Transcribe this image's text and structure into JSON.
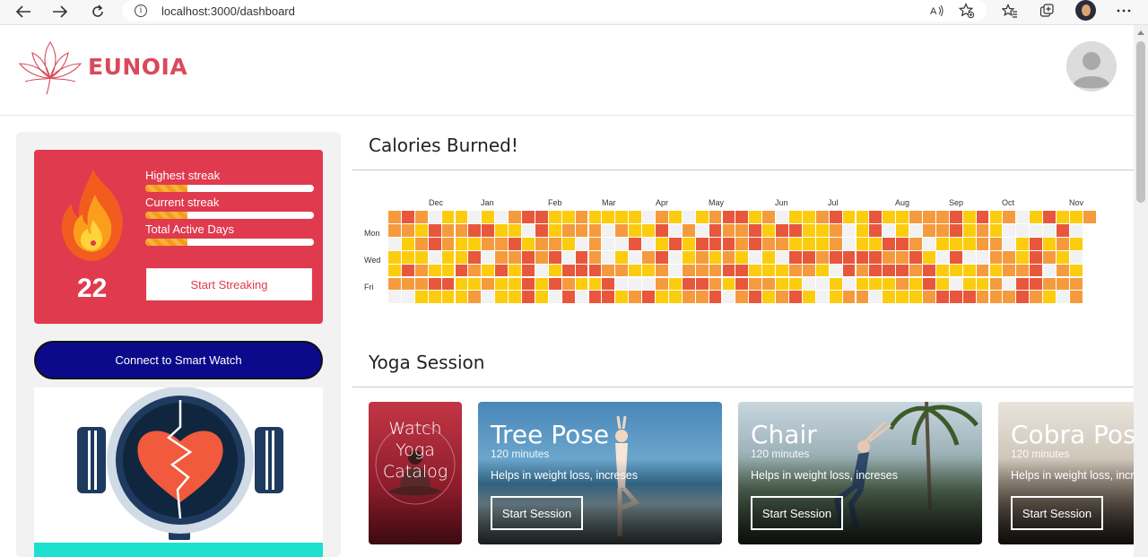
{
  "browser": {
    "url": "localhost:3000/dashboard"
  },
  "header": {
    "brand": "EUNOIA"
  },
  "streak": {
    "count": "22",
    "stats": [
      {
        "label": "Highest streak",
        "fill": 0.25
      },
      {
        "label": "Current streak",
        "fill": 0.25
      },
      {
        "label": "Total Active Days",
        "fill": 0.25
      }
    ],
    "button": "Start Streaking"
  },
  "sidebar": {
    "connect_button": "Connect to Smart Watch"
  },
  "calories": {
    "title": "Calories Burned!",
    "months": [
      "Dec",
      "Jan",
      "Feb",
      "Mar",
      "Apr",
      "May",
      "Jun",
      "Jul",
      "Aug",
      "Sep",
      "Oct",
      "Nov"
    ],
    "days": [
      "Mon",
      "Wed",
      "Fri"
    ],
    "colors": [
      "#f2f2f2",
      "#fccc0f",
      "#f59b3e",
      "#e8573b"
    ]
  },
  "yoga": {
    "title": "Yoga Session",
    "catalog": [
      "Watch",
      "Yoga",
      "Catalog"
    ],
    "cards": [
      {
        "name": "Tree Pose",
        "duration": "120 minutes",
        "description": "Helps in weight loss, increses",
        "button": "Start Session"
      },
      {
        "name": "Chair",
        "duration": "120 minutes",
        "description": "Helps in weight loss, increses",
        "button": "Start Session"
      },
      {
        "name": "Cobra Pose",
        "duration": "120 minutes",
        "description": "Helps in weight loss, increses",
        "button": "Start Session"
      }
    ]
  },
  "colors": {
    "brand": "#d94a5a",
    "streak_card": "#e03a4e",
    "connect_button": "#0a0a8a",
    "watch_band": "#1de0cf"
  }
}
